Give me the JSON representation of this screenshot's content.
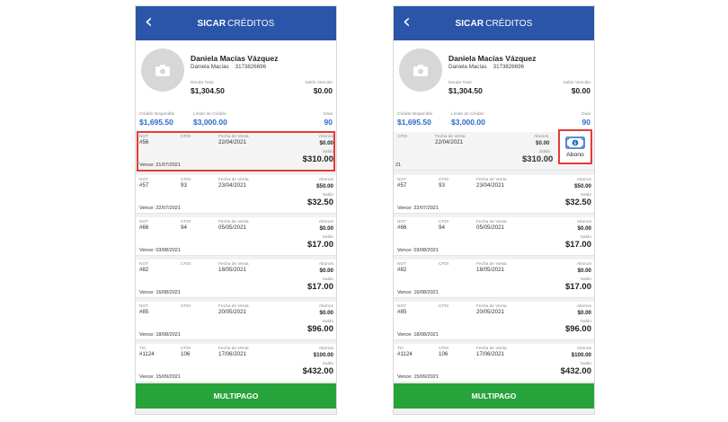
{
  "header": {
    "app_name": "SICAR",
    "section": "CRÉDITOS",
    "back_icon": "chevron-left-icon"
  },
  "customer": {
    "name": "Daniela Macías Vázquez",
    "short_name": "Daniela Macías",
    "phone": "3173826696",
    "avatar_icon": "camera-icon"
  },
  "summary": {
    "deuda_total_label": "Deuda Total",
    "deuda_total": "$1,304.50",
    "saldo_vencido_label": "Saldo Vencido",
    "saldo_vencido": "$0.00",
    "credito_disponible_label": "Crédito Disponible",
    "credito_disponible": "$1,695.50",
    "limite_label": "Límite de Crédito",
    "limite": "$3,000.00",
    "dias_label": "Días",
    "dias": "90"
  },
  "labels": {
    "fecha_de_venta": "Fecha de Venta",
    "abonos": "Abonos",
    "saldo": "Saldo",
    "cfdi": "CFDI"
  },
  "credits": [
    {
      "type": "NOT",
      "folio": "#56",
      "cfdi": "",
      "fecha": "22/04/2021",
      "abonos": "$0.00",
      "saldo": "$310.00",
      "vence": "Vence: 21/07/2021",
      "vence_partial": "21"
    },
    {
      "type": "NOT",
      "folio": "#57",
      "cfdi": "93",
      "fecha": "23/04/2021",
      "abonos": "$50.00",
      "saldo": "$32.50",
      "vence": "Vence: 22/07/2021"
    },
    {
      "type": "NOT",
      "folio": "#66",
      "cfdi": "94",
      "fecha": "05/05/2021",
      "abonos": "$0.00",
      "saldo": "$17.00",
      "vence": "Vence: 03/08/2021"
    },
    {
      "type": "NOT",
      "folio": "#82",
      "cfdi": "",
      "fecha": "18/05/2021",
      "abonos": "$0.00",
      "saldo": "$17.00",
      "vence": "Vence: 16/08/2021"
    },
    {
      "type": "NOT",
      "folio": "#85",
      "cfdi": "",
      "fecha": "20/05/2021",
      "abonos": "$0.00",
      "saldo": "$96.00",
      "vence": "Vence: 18/08/2021"
    },
    {
      "type": "TIC",
      "folio": "#1124",
      "cfdi": "106",
      "fecha": "17/06/2021",
      "abonos": "$100.00",
      "saldo": "$432.00",
      "vence": "Vence: 15/09/2021"
    }
  ],
  "abono_action": {
    "label": "Abono",
    "icon": "money-icon"
  },
  "footer": {
    "multipago": "MULTIPAGO"
  },
  "colors": {
    "header": "#2a55a8",
    "accent_blue": "#2a6ac9",
    "footer": "#27a33b",
    "highlight": "#e53b3b"
  }
}
